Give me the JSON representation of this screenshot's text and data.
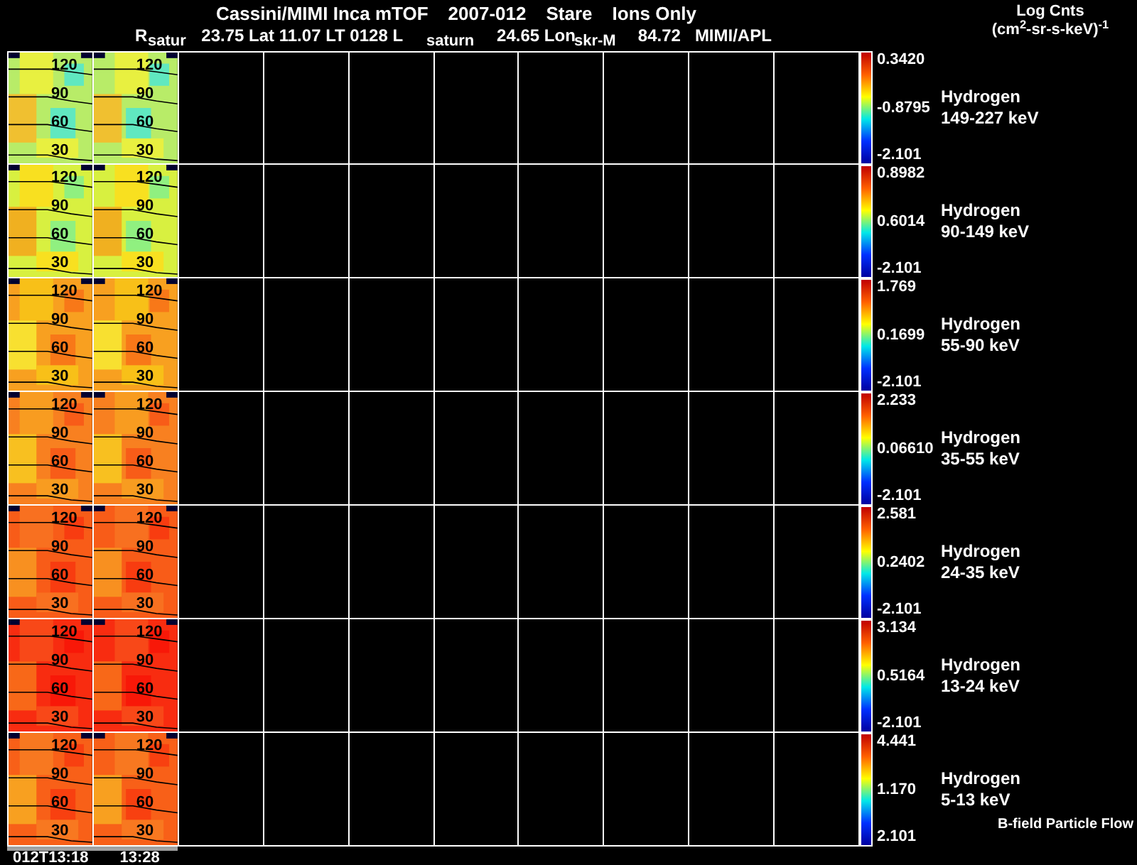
{
  "header": {
    "title_parts": [
      "Cassini/MIMI Inca mTOF",
      "2007-012",
      "Stare",
      "Ions Only"
    ],
    "info_parts": [
      "R",
      "23.75 Lat 11.07 LT 0128 L",
      "24.65 Lon",
      "84.72",
      "MIMI/APL"
    ],
    "units_title": "Log Cnts",
    "units": "(cm$^{2}$-sr-s-keV)$^{-1}$"
  },
  "overlay_labels": [
    "satur",
    "saturn",
    "skr-M"
  ],
  "panels": [
    {
      "species": "Hydrogen",
      "energy": "149-227 keV",
      "scale_max": "0.3420",
      "scale_mid": "-0.8795",
      "scale_min": "-2.101",
      "images": [
        {
          "contours": [
            "120",
            "90",
            "60",
            "30"
          ]
        },
        {
          "contours": [
            "120",
            "90",
            "60",
            "30"
          ]
        }
      ]
    },
    {
      "species": "Hydrogen",
      "energy": "90-149 keV",
      "scale_max": "0.8982",
      "scale_mid": "0.6014",
      "scale_min": "-2.101",
      "images": [
        {
          "contours": [
            "120",
            "90",
            "60",
            "30"
          ]
        },
        {
          "contours": [
            "120",
            "90",
            "60",
            "30"
          ]
        }
      ]
    },
    {
      "species": "Hydrogen",
      "energy": "55-90 keV",
      "scale_max": "1.769",
      "scale_mid": "0.1699",
      "scale_min": "-2.101",
      "images": [
        {
          "contours": [
            "120",
            "90",
            "60",
            "30"
          ]
        },
        {
          "contours": [
            "120",
            "90",
            "60",
            "30"
          ]
        }
      ]
    },
    {
      "species": "Hydrogen",
      "energy": "35-55 keV",
      "scale_max": "2.233",
      "scale_mid": "0.06610",
      "scale_min": "-2.101",
      "images": [
        {
          "contours": [
            "120",
            "90",
            "60",
            "30"
          ]
        },
        {
          "contours": [
            "120",
            "90",
            "60",
            "30"
          ]
        }
      ]
    },
    {
      "species": "Hydrogen",
      "energy": "24-35 keV",
      "scale_max": "2.581",
      "scale_mid": "0.2402",
      "scale_min": "-2.101",
      "images": [
        {
          "contours": [
            "120",
            "90",
            "60",
            "30"
          ]
        },
        {
          "contours": [
            "120",
            "90",
            "60",
            "30"
          ]
        }
      ]
    },
    {
      "species": "Hydrogen",
      "energy": "13-24 keV",
      "scale_max": "3.134",
      "scale_mid": "0.5164",
      "scale_min": "-2.101",
      "images": [
        {
          "contours": [
            "120",
            "90",
            "60",
            "30"
          ]
        },
        {
          "contours": [
            "120",
            "90",
            "60",
            "30"
          ]
        }
      ]
    },
    {
      "species": "Hydrogen",
      "energy": "5-13 keV",
      "scale_max": "4.441",
      "scale_mid": "1.170",
      "scale_min": "2.101",
      "images": [
        {
          "contours": [
            "120",
            "90",
            "60",
            "30"
          ]
        },
        {
          "contours": [
            "120",
            "90",
            "60",
            "30"
          ]
        }
      ]
    }
  ],
  "footnote": "B-field Particle Flow",
  "time_labels": [
    "012T13:18",
    "13:28"
  ]
}
